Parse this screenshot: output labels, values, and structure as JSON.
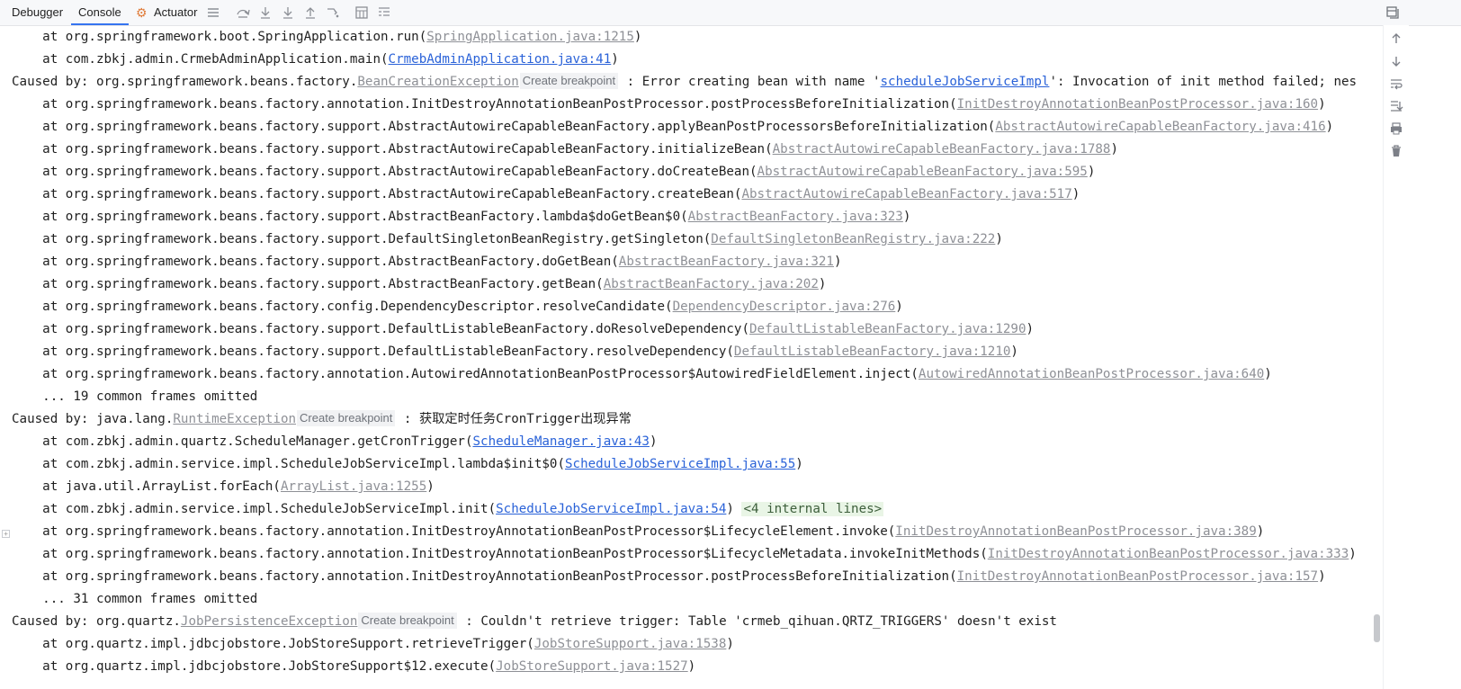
{
  "tabs": [
    {
      "label": "Debugger"
    },
    {
      "label": "Console"
    },
    {
      "label": "Actuator"
    }
  ],
  "tools": [
    "menu-icon",
    "step-over-icon",
    "step-into-icon",
    "force-step-into-icon",
    "step-out-icon",
    "run-to-cursor-icon",
    "evaluate-icon",
    "frames-icon"
  ],
  "sidebar_tools": [
    "scroll-up-icon",
    "scroll-down-icon",
    "soft-wrap-icon",
    "scroll-to-end-icon",
    "print-icon",
    "clear-icon"
  ],
  "breakpoint_label": "Create breakpoint",
  "lines": [
    {
      "segs": [
        {
          "t": "    at org.springframework.boot.SpringApplication.run("
        },
        {
          "t": "SpringApplication.java:1215",
          "c": "lib"
        },
        {
          "t": ")"
        }
      ]
    },
    {
      "segs": [
        {
          "t": "    at com.zbkj.admin.CrmebAdminApplication.main("
        },
        {
          "t": "CrmebAdminApplication.java:41",
          "c": "link"
        },
        {
          "t": ")"
        }
      ]
    },
    {
      "segs": [
        {
          "t": "Caused by: org.springframework.beans.factory."
        },
        {
          "t": "BeanCreationException",
          "c": "lib"
        },
        {
          "t": "",
          "c": "bp"
        },
        {
          "t": " : Error creating bean with name '"
        },
        {
          "t": "scheduleJobServiceImpl",
          "c": "link"
        },
        {
          "t": "': Invocation of init method failed; nes"
        }
      ]
    },
    {
      "segs": [
        {
          "t": "    at org.springframework.beans.factory.annotation.InitDestroyAnnotationBeanPostProcessor.postProcessBeforeInitialization("
        },
        {
          "t": "InitDestroyAnnotationBeanPostProcessor.java:160",
          "c": "lib"
        },
        {
          "t": ")"
        }
      ]
    },
    {
      "segs": [
        {
          "t": "    at org.springframework.beans.factory.support.AbstractAutowireCapableBeanFactory.applyBeanPostProcessorsBeforeInitialization("
        },
        {
          "t": "AbstractAutowireCapableBeanFactory.java:416",
          "c": "lib"
        },
        {
          "t": ")"
        }
      ]
    },
    {
      "segs": [
        {
          "t": "    at org.springframework.beans.factory.support.AbstractAutowireCapableBeanFactory.initializeBean("
        },
        {
          "t": "AbstractAutowireCapableBeanFactory.java:1788",
          "c": "lib"
        },
        {
          "t": ")"
        }
      ]
    },
    {
      "segs": [
        {
          "t": "    at org.springframework.beans.factory.support.AbstractAutowireCapableBeanFactory.doCreateBean("
        },
        {
          "t": "AbstractAutowireCapableBeanFactory.java:595",
          "c": "lib"
        },
        {
          "t": ")"
        }
      ]
    },
    {
      "segs": [
        {
          "t": "    at org.springframework.beans.factory.support.AbstractAutowireCapableBeanFactory.createBean("
        },
        {
          "t": "AbstractAutowireCapableBeanFactory.java:517",
          "c": "lib"
        },
        {
          "t": ")"
        }
      ]
    },
    {
      "segs": [
        {
          "t": "    at org.springframework.beans.factory.support.AbstractBeanFactory.lambda$doGetBean$0("
        },
        {
          "t": "AbstractBeanFactory.java:323",
          "c": "lib"
        },
        {
          "t": ")"
        }
      ]
    },
    {
      "segs": [
        {
          "t": "    at org.springframework.beans.factory.support.DefaultSingletonBeanRegistry.getSingleton("
        },
        {
          "t": "DefaultSingletonBeanRegistry.java:222",
          "c": "lib"
        },
        {
          "t": ")"
        }
      ]
    },
    {
      "segs": [
        {
          "t": "    at org.springframework.beans.factory.support.AbstractBeanFactory.doGetBean("
        },
        {
          "t": "AbstractBeanFactory.java:321",
          "c": "lib"
        },
        {
          "t": ")"
        }
      ]
    },
    {
      "segs": [
        {
          "t": "    at org.springframework.beans.factory.support.AbstractBeanFactory.getBean("
        },
        {
          "t": "AbstractBeanFactory.java:202",
          "c": "lib"
        },
        {
          "t": ")"
        }
      ]
    },
    {
      "segs": [
        {
          "t": "    at org.springframework.beans.factory.config.DependencyDescriptor.resolveCandidate("
        },
        {
          "t": "DependencyDescriptor.java:276",
          "c": "lib"
        },
        {
          "t": ")"
        }
      ]
    },
    {
      "segs": [
        {
          "t": "    at org.springframework.beans.factory.support.DefaultListableBeanFactory.doResolveDependency("
        },
        {
          "t": "DefaultListableBeanFactory.java:1290",
          "c": "lib"
        },
        {
          "t": ")"
        }
      ]
    },
    {
      "segs": [
        {
          "t": "    at org.springframework.beans.factory.support.DefaultListableBeanFactory.resolveDependency("
        },
        {
          "t": "DefaultListableBeanFactory.java:1210",
          "c": "lib"
        },
        {
          "t": ")"
        }
      ]
    },
    {
      "segs": [
        {
          "t": "    at org.springframework.beans.factory.annotation.AutowiredAnnotationBeanPostProcessor$AutowiredFieldElement.inject("
        },
        {
          "t": "AutowiredAnnotationBeanPostProcessor.java:640",
          "c": "lib"
        },
        {
          "t": ")"
        }
      ]
    },
    {
      "segs": [
        {
          "t": "    ... 19 common frames omitted"
        }
      ]
    },
    {
      "segs": [
        {
          "t": "Caused by: java.lang."
        },
        {
          "t": "RuntimeException",
          "c": "lib"
        },
        {
          "t": "",
          "c": "bp"
        },
        {
          "t": " : 获取定时任务CronTrigger出现异常"
        }
      ]
    },
    {
      "segs": [
        {
          "t": "    at com.zbkj.admin.quartz.ScheduleManager.getCronTrigger("
        },
        {
          "t": "ScheduleManager.java:43",
          "c": "link"
        },
        {
          "t": ")"
        }
      ]
    },
    {
      "segs": [
        {
          "t": "    at com.zbkj.admin.service.impl.ScheduleJobServiceImpl.lambda$init$0("
        },
        {
          "t": "ScheduleJobServiceImpl.java:55",
          "c": "link"
        },
        {
          "t": ")"
        }
      ]
    },
    {
      "segs": [
        {
          "t": "    at java.util.ArrayList.forEach("
        },
        {
          "t": "ArrayList.java:1255",
          "c": "lib"
        },
        {
          "t": ")"
        }
      ]
    },
    {
      "segs": [
        {
          "t": "    at com.zbkj.admin.service.impl.ScheduleJobServiceImpl.init("
        },
        {
          "t": "ScheduleJobServiceImpl.java:54",
          "c": "link"
        },
        {
          "t": ") "
        },
        {
          "t": "<4 internal lines>",
          "c": "internal"
        }
      ]
    },
    {
      "segs": [
        {
          "t": "    at org.springframework.beans.factory.annotation.InitDestroyAnnotationBeanPostProcessor$LifecycleElement.invoke("
        },
        {
          "t": "InitDestroyAnnotationBeanPostProcessor.java:389",
          "c": "lib"
        },
        {
          "t": ")"
        }
      ]
    },
    {
      "segs": [
        {
          "t": "    at org.springframework.beans.factory.annotation.InitDestroyAnnotationBeanPostProcessor$LifecycleMetadata.invokeInitMethods("
        },
        {
          "t": "InitDestroyAnnotationBeanPostProcessor.java:333",
          "c": "lib"
        },
        {
          "t": ")"
        }
      ]
    },
    {
      "segs": [
        {
          "t": "    at org.springframework.beans.factory.annotation.InitDestroyAnnotationBeanPostProcessor.postProcessBeforeInitialization("
        },
        {
          "t": "InitDestroyAnnotationBeanPostProcessor.java:157",
          "c": "lib"
        },
        {
          "t": ")"
        }
      ]
    },
    {
      "segs": [
        {
          "t": "    ... 31 common frames omitted"
        }
      ]
    },
    {
      "segs": [
        {
          "t": "Caused by: org.quartz."
        },
        {
          "t": "JobPersistenceException",
          "c": "lib"
        },
        {
          "t": "",
          "c": "bp"
        },
        {
          "t": " : Couldn't retrieve trigger: Table 'crmeb_qihuan.QRTZ_TRIGGERS' doesn't exist"
        }
      ]
    },
    {
      "segs": [
        {
          "t": "    at org.quartz.impl.jdbcjobstore.JobStoreSupport.retrieveTrigger("
        },
        {
          "t": "JobStoreSupport.java:1538",
          "c": "lib"
        },
        {
          "t": ")"
        }
      ]
    },
    {
      "segs": [
        {
          "t": "    at org.quartz.impl.jdbcjobstore.JobStoreSupport$12.execute("
        },
        {
          "t": "JobStoreSupport.java:1527",
          "c": "lib"
        },
        {
          "t": ")"
        }
      ]
    }
  ]
}
